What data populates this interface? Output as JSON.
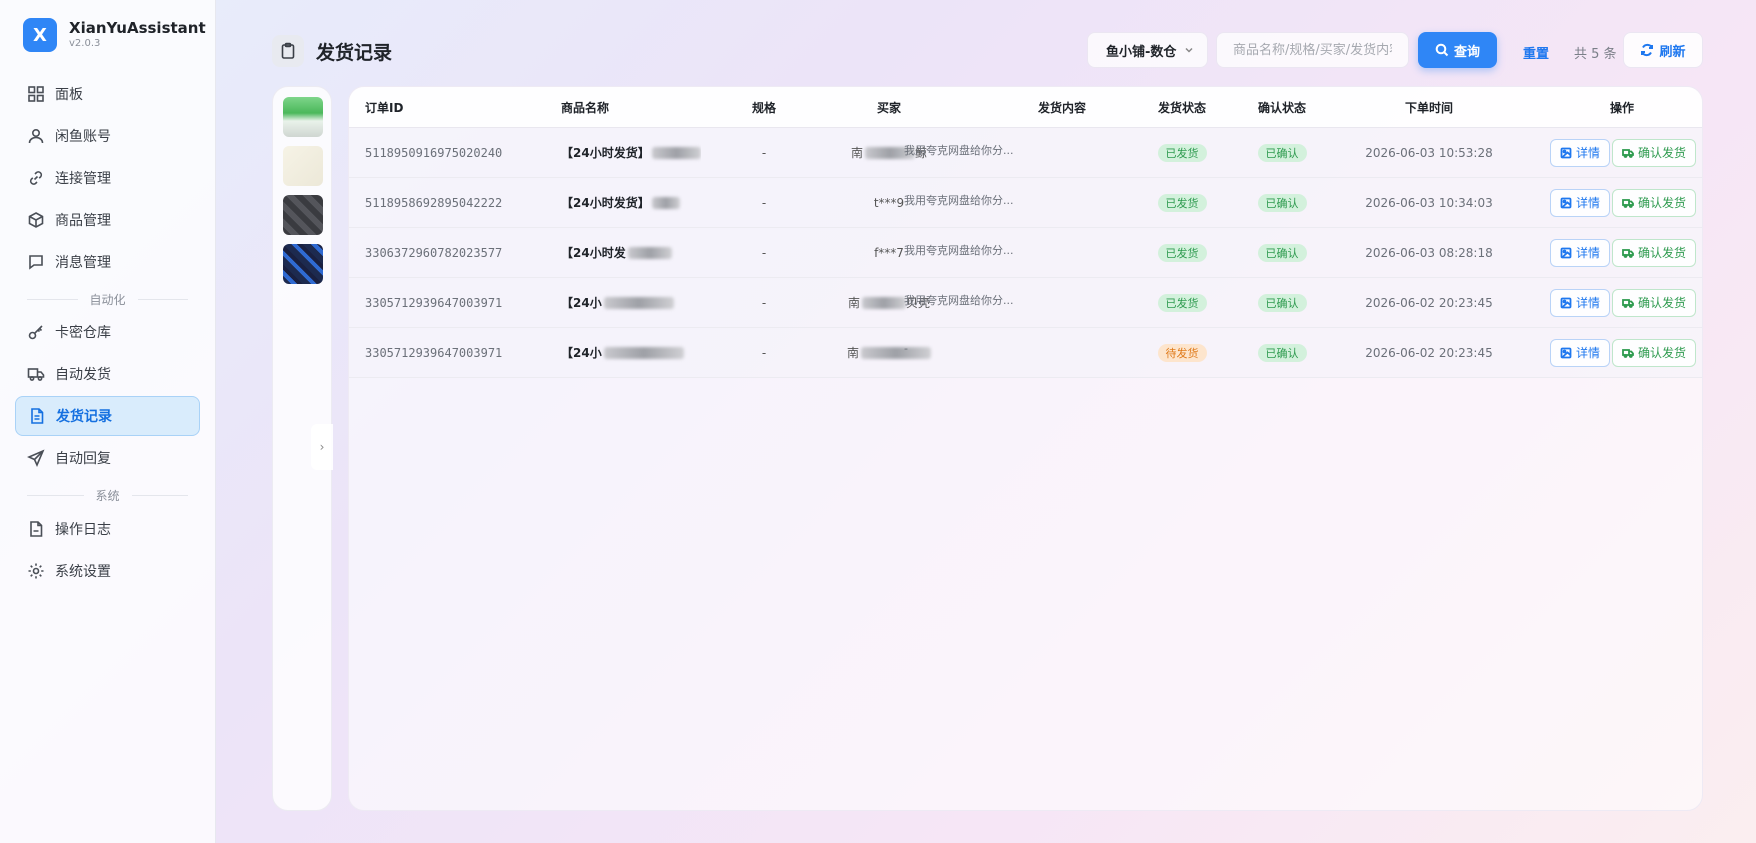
{
  "app": {
    "name": "XianYuAssistant",
    "version": "v2.0.3",
    "logo_letter": "X"
  },
  "sidebar": {
    "items": [
      {
        "label": "面板",
        "icon": "grid-icon"
      },
      {
        "label": "闲鱼账号",
        "icon": "user-icon"
      },
      {
        "label": "连接管理",
        "icon": "link-icon"
      },
      {
        "label": "商品管理",
        "icon": "box-icon"
      },
      {
        "label": "消息管理",
        "icon": "message-icon"
      }
    ],
    "section_automation": "自动化",
    "automation_items": [
      {
        "label": "卡密仓库",
        "icon": "key-icon"
      },
      {
        "label": "自动发货",
        "icon": "truck-icon"
      },
      {
        "label": "发货记录",
        "icon": "document-icon",
        "active": true
      },
      {
        "label": "自动回复",
        "icon": "send-icon"
      }
    ],
    "section_system": "系统",
    "system_items": [
      {
        "label": "操作日志",
        "icon": "log-icon"
      },
      {
        "label": "系统设置",
        "icon": "gear-icon"
      }
    ]
  },
  "header": {
    "title": "发货记录",
    "shop_select": "鱼小铺-数仓",
    "search_placeholder": "商品名称/规格/买家/发货内容",
    "query_label": "查询",
    "reset_label": "重置",
    "total_text": "共 5 条",
    "refresh_label": "刷新"
  },
  "collapse_arrow": "›",
  "table": {
    "columns": [
      "订单ID",
      "商品名称",
      "规格",
      "买家",
      "发货内容",
      "发货状态",
      "确认状态",
      "下单时间",
      "操作"
    ],
    "detail_label": "详情",
    "confirm_label": "确认发货",
    "rows": [
      {
        "order_id": "5118950916975020240",
        "product": "【24小时发货】",
        "spec": "-",
        "buyer_prefix": "南",
        "buyer_suffix": "鲸",
        "content": "我用夸克网盘给你分...",
        "ship_status": "已发货",
        "confirm_status": "已确认",
        "time": "2026-06-03 10:53:28"
      },
      {
        "order_id": "5118958692895042222",
        "product": "【24小时发货】",
        "spec": "-",
        "buyer_prefix": "t***9",
        "buyer_suffix": "",
        "content": "我用夸克网盘给你分...",
        "ship_status": "已发货",
        "confirm_status": "已确认",
        "time": "2026-06-03 10:34:03"
      },
      {
        "order_id": "3306372960782023577",
        "product": "【24小时发",
        "spec": "-",
        "buyer_prefix": "f***7",
        "buyer_suffix": "",
        "content": "我用夸克网盘给你分...",
        "ship_status": "已发货",
        "confirm_status": "已确认",
        "time": "2026-06-03 08:28:18"
      },
      {
        "order_id": "3305712939647003971",
        "product": "【24小",
        "spec": "-",
        "buyer_prefix": "南",
        "buyer_suffix": "贝壳",
        "content": "我用夸克网盘给你分...",
        "ship_status": "已发货",
        "confirm_status": "已确认",
        "time": "2026-06-02 20:23:45"
      },
      {
        "order_id": "3305712939647003971",
        "product": "【24小",
        "spec": "-",
        "buyer_prefix": "南",
        "buyer_suffix": "",
        "content": "-",
        "ship_status": "待发货",
        "confirm_status": "已确认",
        "time": "2026-06-02 20:23:45"
      }
    ]
  },
  "colors": {
    "accent": "#2f86f6",
    "shipped": "#2e9b4f",
    "pending": "#e07a1a"
  }
}
